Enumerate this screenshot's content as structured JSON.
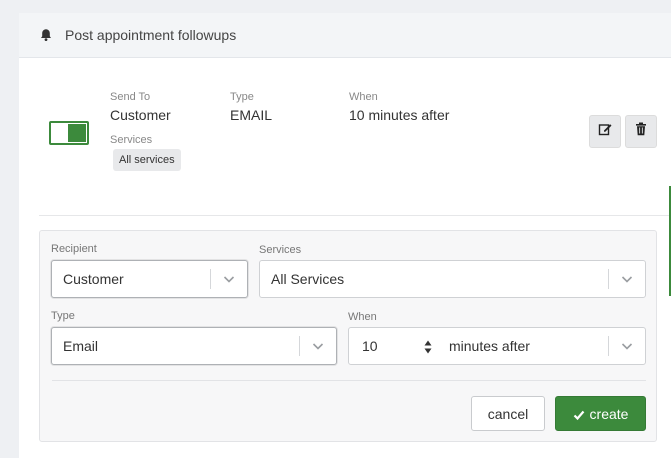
{
  "header": {
    "title": "Post appointment followups",
    "icon": "bell-icon"
  },
  "followup": {
    "enabled": true,
    "send_to_label": "Send To",
    "send_to_value": "Customer",
    "type_label": "Type",
    "type_value": "EMAIL",
    "when_label": "When",
    "when_value": "10 minutes after",
    "services_label": "Services",
    "services_chip": "All services"
  },
  "form": {
    "recipient_label": "Recipient",
    "recipient_value": "Customer",
    "services_label": "Services",
    "services_value": "All Services",
    "type_label": "Type",
    "type_value": "Email",
    "when_label": "When",
    "when_number": "10",
    "when_unit": "minutes after",
    "cancel_label": "cancel",
    "create_label": "create"
  },
  "colors": {
    "accent": "#3c8a3c"
  }
}
